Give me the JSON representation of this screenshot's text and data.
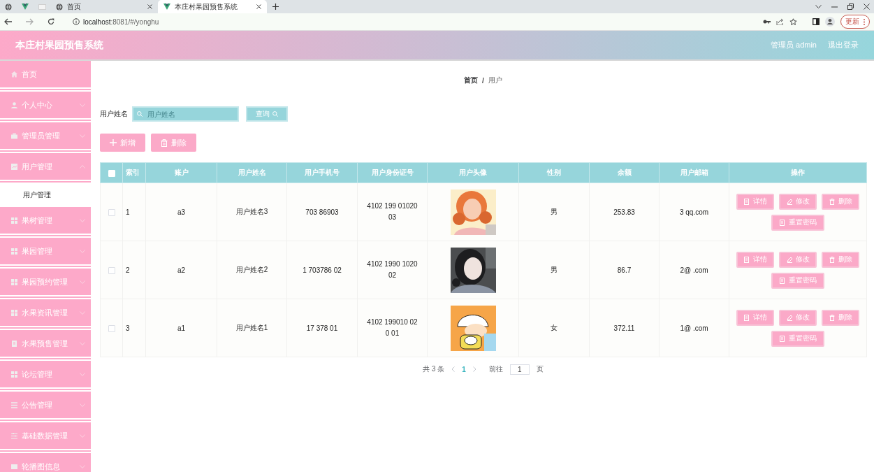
{
  "browser": {
    "tabs": [
      {
        "title": "首页",
        "selected": false
      },
      {
        "title": "本庄村果园预售系统",
        "selected": true
      }
    ],
    "address": {
      "host": "localhost",
      "path": ":8081/#/yonghu"
    },
    "update_button": "更新"
  },
  "header": {
    "title": "本庄村果园预售系统",
    "user": "管理员 admin",
    "logout": "退出登录"
  },
  "sidebar": {
    "items": [
      {
        "label": "首页",
        "kind": "link"
      },
      {
        "label": "个人中心",
        "kind": "submenu",
        "expanded": false
      },
      {
        "label": "管理员管理",
        "kind": "submenu",
        "expanded": false
      },
      {
        "label": "用户管理",
        "kind": "submenu",
        "expanded": true,
        "children": [
          {
            "label": "用户管理",
            "selected": false
          }
        ]
      },
      {
        "label": "果树管理",
        "kind": "submenu",
        "expanded": false
      },
      {
        "label": "果园管理",
        "kind": "submenu",
        "expanded": false
      },
      {
        "label": "果园预约管理",
        "kind": "submenu",
        "expanded": false
      },
      {
        "label": "水果资讯管理",
        "kind": "submenu",
        "expanded": false
      },
      {
        "label": "水果预售管理",
        "kind": "submenu",
        "expanded": false
      },
      {
        "label": "论坛管理",
        "kind": "submenu",
        "expanded": false
      },
      {
        "label": "公告管理",
        "kind": "submenu",
        "expanded": false
      },
      {
        "label": "基础数据管理",
        "kind": "submenu",
        "expanded": false
      },
      {
        "label": "轮播图信息",
        "kind": "submenu",
        "expanded": false
      }
    ]
  },
  "breadcrumb": {
    "items": [
      "首页",
      "用户"
    ],
    "separator": "/"
  },
  "search": {
    "label": "用户姓名",
    "placeholder": "用户姓名",
    "button": "查询"
  },
  "toolbar": [
    {
      "kind": "add",
      "label": "新增"
    },
    {
      "kind": "delete",
      "label": "删除"
    }
  ],
  "table": {
    "select_all": {
      "checked": false
    },
    "columns": [
      "索引",
      "账户",
      "用户姓名",
      "用户手机号",
      "用户身份证号",
      "用户头像",
      "性别",
      "余额",
      "用户邮箱",
      "操作"
    ],
    "rows": [
      {
        "checked": false,
        "index": "1",
        "account": "a3",
        "name": "用户姓名3",
        "phone": "703 86903",
        "id_number": "4102 199 01020 03",
        "gender": "男",
        "balance": "253.83",
        "email": "3 qq.com",
        "actions": [
          {
            "kind": "detail",
            "label": "详情"
          },
          {
            "kind": "edit",
            "label": "修改"
          },
          {
            "kind": "delete",
            "label": "删除"
          },
          {
            "kind": "reset",
            "label": "重置密码"
          }
        ]
      },
      {
        "checked": false,
        "index": "2",
        "account": "a2",
        "name": "用户姓名2",
        "phone": "1 703786 02",
        "id_number": "4102 1990 1020 02",
        "gender": "男",
        "balance": "86.7",
        "email": "2@ .com",
        "actions": [
          {
            "kind": "detail",
            "label": "详情"
          },
          {
            "kind": "edit",
            "label": "修改"
          },
          {
            "kind": "delete",
            "label": "删除"
          },
          {
            "kind": "reset",
            "label": "重置密码"
          }
        ]
      },
      {
        "checked": false,
        "index": "3",
        "account": "a1",
        "name": "用户姓名1",
        "phone": "17 378 01",
        "id_number": "4102 199010 020 01",
        "gender": "女",
        "balance": "372.11",
        "email": "1@ .com",
        "actions": [
          {
            "kind": "detail",
            "label": "详情"
          },
          {
            "kind": "edit",
            "label": "修改"
          },
          {
            "kind": "delete",
            "label": "删除"
          },
          {
            "kind": "reset",
            "label": "重置密码"
          }
        ]
      }
    ]
  },
  "pagination": {
    "total": "共 3 条",
    "pages": [
      {
        "label": "1",
        "selected": true
      }
    ],
    "goto_label": "前往",
    "goto_value": "1",
    "goto_suffix": "页"
  }
}
